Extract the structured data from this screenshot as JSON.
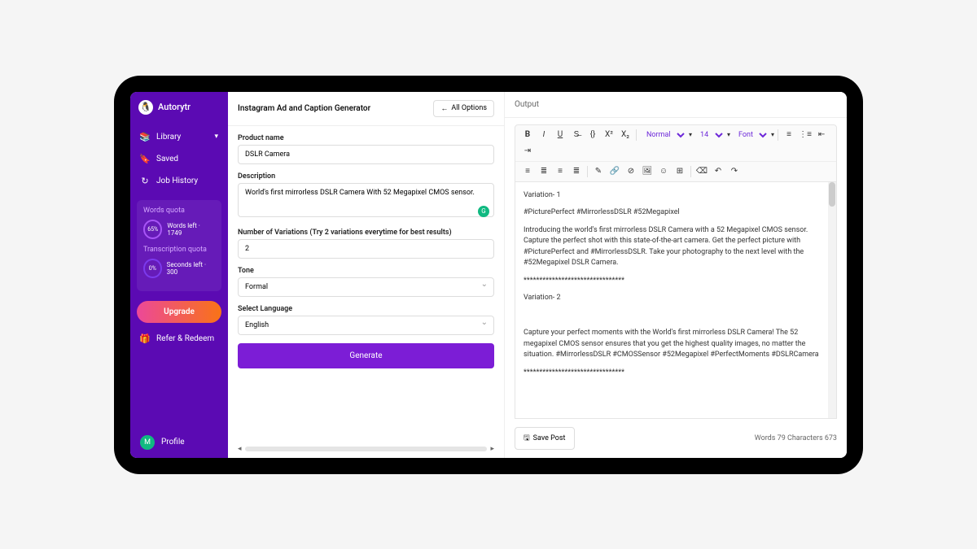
{
  "sidebar": {
    "brand": "Autorytr",
    "nav": [
      {
        "icon": "📚",
        "label": "Library",
        "hasChevron": true
      },
      {
        "icon": "🔖",
        "label": "Saved"
      },
      {
        "icon": "↻",
        "label": "Job History"
      }
    ],
    "wordsQuota": {
      "title": "Words quota",
      "percent": "65%",
      "text": "Words left · 1749"
    },
    "transQuota": {
      "title": "Transcription quota",
      "percent": "0%",
      "text": "Seconds left · 300"
    },
    "upgrade": "Upgrade",
    "refer": {
      "icon": "🎁",
      "label": "Refer & Redeem"
    },
    "profile": {
      "initial": "M",
      "label": "Profile"
    }
  },
  "form": {
    "title": "Instagram Ad and Caption Generator",
    "allOptions": "All Options",
    "productName": {
      "label": "Product name",
      "value": "DSLR Camera"
    },
    "description": {
      "label": "Description",
      "value": "World's first mirrorless DSLR Camera With 52 Megapixel CMOS sensor."
    },
    "variations": {
      "label": "Number of Variations (Try 2 variations everytime for best results)",
      "value": "2"
    },
    "tone": {
      "label": "Tone",
      "value": "Formal"
    },
    "language": {
      "label": "Select Language",
      "value": "English"
    },
    "generate": "Generate"
  },
  "output": {
    "title": "Output",
    "toolbar": {
      "style": "Normal",
      "size": "14",
      "font": "Font"
    },
    "content": {
      "v1title": "Variation- 1",
      "v1tags": "#PicturePerfect #MirrorlessDSLR #52Megapixel",
      "v1body": "Introducing the world's first mirrorless DSLR Camera with a 52 Megapixel CMOS sensor. Capture the perfect shot with this state-of-the-art camera. Get the perfect picture with #PicturePerfect and #MirrorlessDSLR. Take your photography to the next level with the #52Megapixel DSLR Camera.",
      "sep": "********************************",
      "v2title": "Variation- 2",
      "v2body": "Capture your perfect moments with the World's first mirrorless DSLR Camera! The 52 megapixel CMOS sensor ensures that you get the highest quality images, no matter the situation. #MirrorlessDSLR #CMOSSensor #52Megapixel #PerfectMoments #DSLRCamera"
    },
    "savePost": "Save Post",
    "wordCount": "Words 79   Characters 673"
  }
}
